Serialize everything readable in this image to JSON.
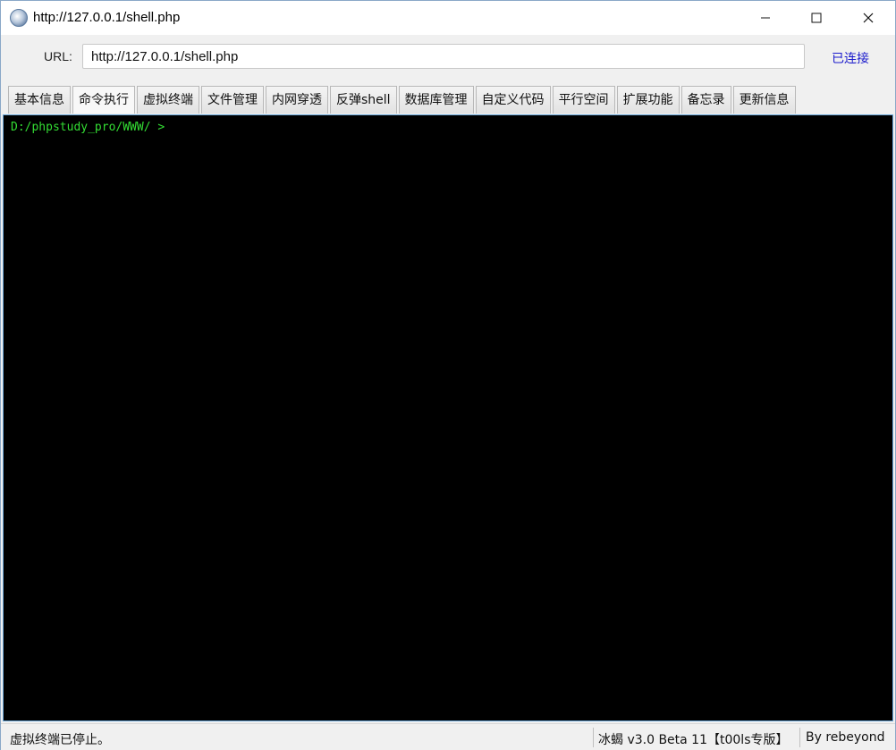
{
  "window": {
    "title": "http://127.0.0.1/shell.php",
    "icon": "app-logo-icon"
  },
  "url_bar": {
    "label": "URL:",
    "value": "http://127.0.0.1/shell.php",
    "status": "已连接"
  },
  "tabs": [
    {
      "label": "基本信息",
      "active": false
    },
    {
      "label": "命令执行",
      "active": true
    },
    {
      "label": "虚拟终端",
      "active": false
    },
    {
      "label": "文件管理",
      "active": false
    },
    {
      "label": "内网穿透",
      "active": false
    },
    {
      "label": "反弹shell",
      "active": false
    },
    {
      "label": "数据库管理",
      "active": false
    },
    {
      "label": "自定义代码",
      "active": false
    },
    {
      "label": "平行空间",
      "active": false
    },
    {
      "label": "扩展功能",
      "active": false
    },
    {
      "label": "备忘录",
      "active": false
    },
    {
      "label": "更新信息",
      "active": false
    }
  ],
  "terminal": {
    "prompt": "D:/phpstudy_pro/WWW/ >",
    "prompt_color": "#33dd33",
    "background": "#000000"
  },
  "statusbar": {
    "message": "虚拟终端已停止。",
    "version": "冰蝎 v3.0 Beta 11【t00ls专版】",
    "author": "By rebeyond"
  }
}
